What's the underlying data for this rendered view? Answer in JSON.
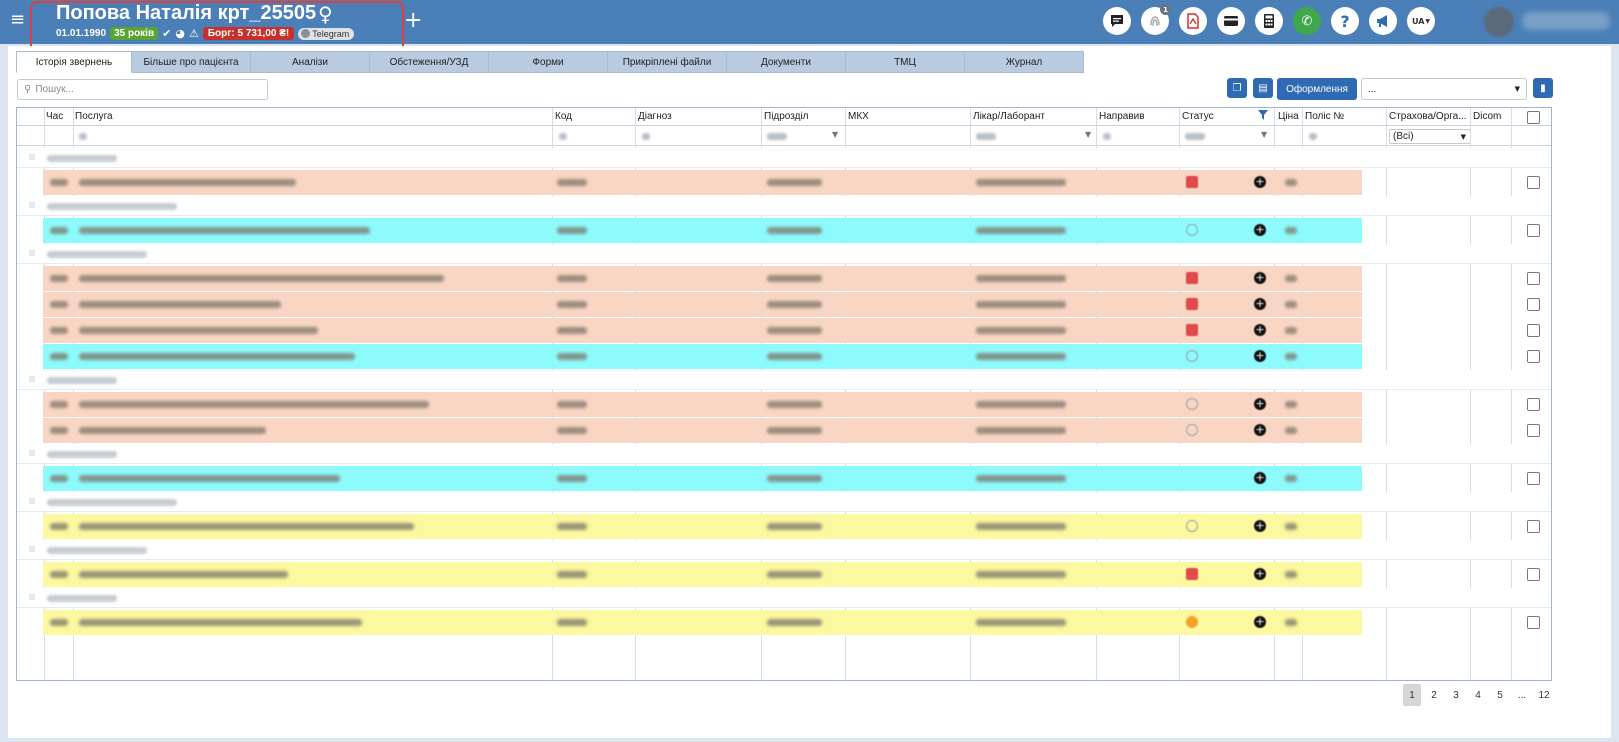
{
  "header": {
    "patient_name": "Попова Наталія крт_25505",
    "gender_symbol": "♀",
    "dob": "01.01.1990",
    "age": "35 років",
    "debt": "Борг: 5 731,00 ₴!",
    "telegram": "Telegram",
    "language": "UA",
    "notification_count": "1",
    "colors": {
      "topbar": "#4a7fb8",
      "highlight_box": "#e0403a",
      "age_badge": "#5aa531",
      "debt_badge": "#c9302c"
    }
  },
  "toolbar_icons": [
    "chat-icon",
    "fingerprint-icon",
    "pdf-icon",
    "card-icon",
    "calculator-icon",
    "phone-icon",
    "help-icon",
    "megaphone-icon",
    "language-icon"
  ],
  "tabs": [
    {
      "label": "Історія звернень",
      "active": true
    },
    {
      "label": "Більше про пацієнта"
    },
    {
      "label": "Аналізи"
    },
    {
      "label": "Обстеження/УЗД"
    },
    {
      "label": "Форми"
    },
    {
      "label": "Прикріплені файли"
    },
    {
      "label": "Документи"
    },
    {
      "label": "ТМЦ"
    },
    {
      "label": "Журнал"
    }
  ],
  "search": {
    "placeholder": "Пошук..."
  },
  "actions": {
    "format_button": "Оформлення",
    "select_value": "..."
  },
  "columns": [
    "Час",
    "Послуга",
    "Код",
    "Діагноз",
    "Підрозділ",
    "МКХ",
    "Лікар/Лаборант",
    "Направив",
    "Статус",
    "Ціна",
    "Поліс №",
    "Страхова/Орга...",
    "Dicom"
  ],
  "filter": {
    "insurer_value": "(Всі)"
  },
  "rows": [
    {
      "type": "group"
    },
    {
      "type": "data",
      "color": "salmon",
      "status": "red"
    },
    {
      "type": "group"
    },
    {
      "type": "data",
      "color": "cyan",
      "status": "grey"
    },
    {
      "type": "group"
    },
    {
      "type": "data",
      "color": "salmon",
      "status": "red"
    },
    {
      "type": "data",
      "color": "salmon",
      "status": "red"
    },
    {
      "type": "data",
      "color": "salmon",
      "status": "red"
    },
    {
      "type": "data",
      "color": "cyan",
      "status": "grey"
    },
    {
      "type": "group"
    },
    {
      "type": "data",
      "color": "salmon",
      "status": "grey"
    },
    {
      "type": "data",
      "color": "salmon",
      "status": "grey"
    },
    {
      "type": "group"
    },
    {
      "type": "data",
      "color": "cyan",
      "status": "none"
    },
    {
      "type": "group"
    },
    {
      "type": "data",
      "color": "yellow",
      "status": "grey"
    },
    {
      "type": "group"
    },
    {
      "type": "data",
      "color": "yellow",
      "status": "red"
    },
    {
      "type": "group"
    },
    {
      "type": "data",
      "color": "yellow",
      "status": "orange"
    }
  ],
  "row_colors": {
    "salmon": "#f9d6c3",
    "cyan": "#8dfbfc",
    "yellow": "#fbf89f"
  },
  "pagination": {
    "pages": [
      "1",
      "2",
      "3",
      "4",
      "5",
      "...",
      "12"
    ],
    "current": "1"
  }
}
